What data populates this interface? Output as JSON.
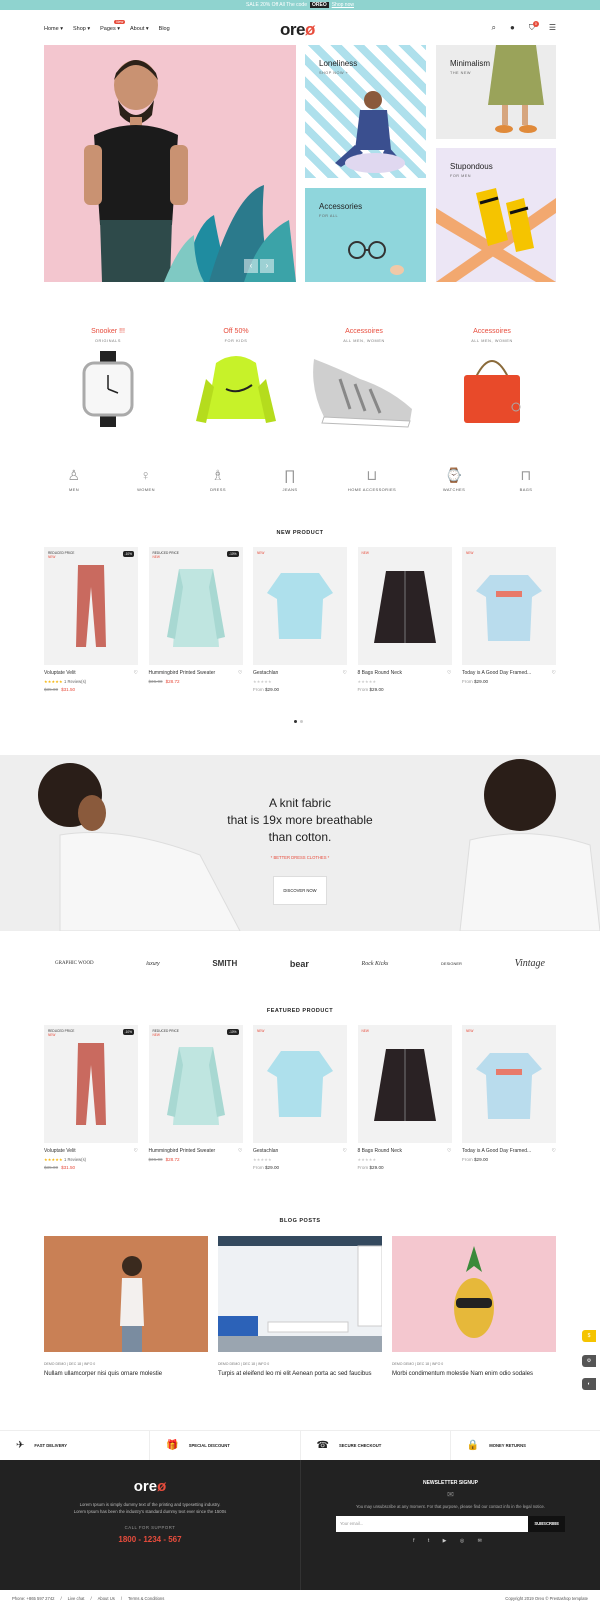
{
  "topbar": {
    "pre": "SALE 20% Off All The code",
    "code": "OREO",
    "link": "Shop now"
  },
  "header": {
    "logo_a": "ore",
    "logo_b": "ø",
    "nav": [
      "Home ▾",
      "Shop ▾",
      "Pages ▾",
      "About ▾",
      "Blog"
    ],
    "nav_badge": "New",
    "cart_count": "0"
  },
  "hero": {
    "tiles": [
      {
        "title": "Loneliness",
        "sub": "SHOP NOW +"
      },
      {
        "title": "Minimalism",
        "sub": "THE NEW"
      },
      {
        "title": "Accessories",
        "sub": "FOR ALL"
      },
      {
        "title": "Stupondous",
        "sub": "FOR MEN"
      }
    ],
    "arrows": [
      "‹",
      "›"
    ]
  },
  "categories": [
    {
      "title": "Snooker !!!",
      "sub": "ORIGINALS"
    },
    {
      "title": "Off 50%",
      "sub": "FOR KIDS"
    },
    {
      "title": "Accessoires",
      "sub": "ALL MEN, WOMEN"
    },
    {
      "title": "Accessoires",
      "sub": "ALL MEN, WOMEN"
    }
  ],
  "cat_icons": [
    "MEN",
    "WOMEN",
    "DRESS",
    "JEANS",
    "HOME ACCESSORIES",
    "WATCHES",
    "BAGS"
  ],
  "new_product": {
    "title": "NEW PRODUCT"
  },
  "featured_product": {
    "title": "FEATURED PRODUCT"
  },
  "products": [
    {
      "label": "REDUCED PRICE",
      "new": "NEW",
      "pct": "-10%",
      "name": "Voluptate Velit",
      "rating": "★★★★★",
      "reviews": "1 Review(s)",
      "old": "$35.00",
      "price": "$31.50",
      "from": ""
    },
    {
      "label": "REDUCED PRICE",
      "new": "NEW",
      "pct": "-10%",
      "name": "Hummingbird Printed Sweater",
      "rating": "",
      "reviews": "",
      "old": "$36.00",
      "price": "$28.72",
      "from": ""
    },
    {
      "label": "",
      "new": "NEW",
      "pct": "",
      "name": "Gestachlan",
      "rating": "★★★★★",
      "reviews": "",
      "old": "",
      "price": "$29.00",
      "from": "From"
    },
    {
      "label": "",
      "new": "NEW",
      "pct": "",
      "name": "8 Bags Round Neck",
      "rating": "★★★★★",
      "reviews": "",
      "old": "",
      "price": "$29.00",
      "from": "From"
    },
    {
      "label": "",
      "new": "NEW",
      "pct": "",
      "name": "Today is A Good Day Framed...",
      "rating": "",
      "reviews": "",
      "old": "",
      "price": "$29.00",
      "from": "From"
    }
  ],
  "banner": {
    "line1": "A knit fabric",
    "line2": "that is 19x more breathable",
    "line3": "than cotton.",
    "tag": "* BETTER DRESS CLOTHES *",
    "button": "DISCOVER NOW"
  },
  "brands": [
    "GRAPHIC WOOD",
    "luxury",
    "SMITH",
    "bear",
    "Rock Kicks",
    "DESIGNER",
    "Vintage"
  ],
  "blog": {
    "title": "BLOG POSTS",
    "posts": [
      {
        "meta": "DEMO DEMO | DEC 18 | INFO 0",
        "title": "Nullam ullamcorper nisi quis ornare molestie"
      },
      {
        "meta": "DEMO DEMO | DEC 18 | INFO 0",
        "title": "Turpis at eleifend leo mi elit Aenean porta ac sed faucibus"
      },
      {
        "meta": "DEMO DEMO | DEC 18 | INFO 0",
        "title": "Morbi condimentum molestie Nam enim odio sodales"
      }
    ]
  },
  "features": [
    {
      "icon": "✈",
      "label": "FAST DELIVERY"
    },
    {
      "icon": "🎁",
      "label": "SPECIAL DISCOUNT"
    },
    {
      "icon": "☎",
      "label": "SECURE CHECKOUT"
    },
    {
      "icon": "🔒",
      "label": "MONEY RETURNS"
    }
  ],
  "footer": {
    "logo_a": "ore",
    "logo_b": "ø",
    "line1": "Lorem Ipsum is simply dummy text of the printing and typesetting industry.",
    "line2": "Lorem Ipsum has been the industry's standard dummy text ever since the 1500s",
    "call": "CALL FOR SUPPORT",
    "phone": "1800 - 1234 - 567",
    "news_title": "NEWSLETTER SIGNUP",
    "news_text": "You may unsubscribe at any moment. For that purpose, please find our contact info in the legal notice.",
    "placeholder": "Your email...",
    "subscribe": "SUBSCRIBE",
    "social": "f t ▶ ◎ ✉"
  },
  "bottom": {
    "phone": "Phone: +865 597 2742",
    "links": [
      "Live chat",
      "About Us",
      "Terms & Conditions"
    ],
    "copy": "Copyright 2019 Oreo © Prestashop template"
  },
  "colors": {
    "accent": "#e74c3c",
    "topbar": "#8fd3cf",
    "footer": "#222222"
  }
}
